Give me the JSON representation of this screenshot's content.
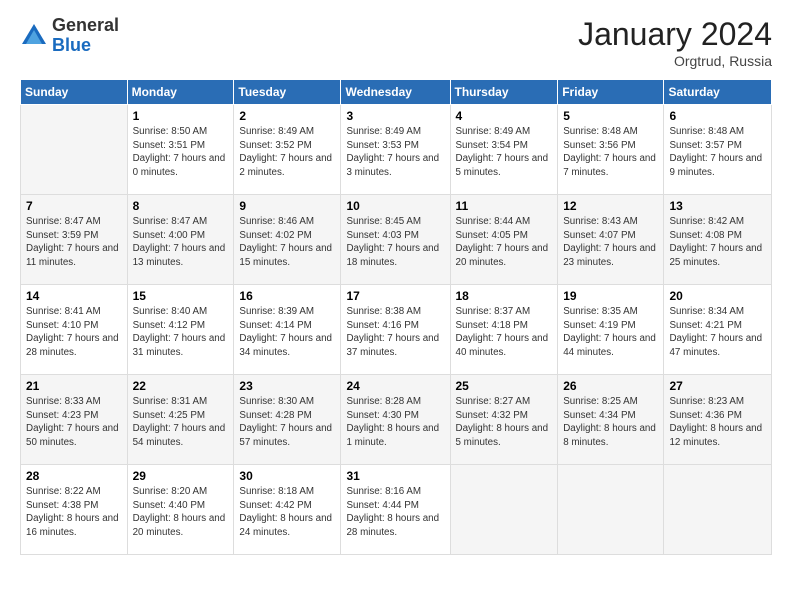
{
  "logo": {
    "general": "General",
    "blue": "Blue"
  },
  "header": {
    "month": "January 2024",
    "location": "Orgtrud, Russia"
  },
  "days_of_week": [
    "Sunday",
    "Monday",
    "Tuesday",
    "Wednesday",
    "Thursday",
    "Friday",
    "Saturday"
  ],
  "weeks": [
    [
      {
        "day": "",
        "empty": true
      },
      {
        "day": "1",
        "sunrise": "Sunrise: 8:50 AM",
        "sunset": "Sunset: 3:51 PM",
        "daylight": "Daylight: 7 hours and 0 minutes."
      },
      {
        "day": "2",
        "sunrise": "Sunrise: 8:49 AM",
        "sunset": "Sunset: 3:52 PM",
        "daylight": "Daylight: 7 hours and 2 minutes."
      },
      {
        "day": "3",
        "sunrise": "Sunrise: 8:49 AM",
        "sunset": "Sunset: 3:53 PM",
        "daylight": "Daylight: 7 hours and 3 minutes."
      },
      {
        "day": "4",
        "sunrise": "Sunrise: 8:49 AM",
        "sunset": "Sunset: 3:54 PM",
        "daylight": "Daylight: 7 hours and 5 minutes."
      },
      {
        "day": "5",
        "sunrise": "Sunrise: 8:48 AM",
        "sunset": "Sunset: 3:56 PM",
        "daylight": "Daylight: 7 hours and 7 minutes."
      },
      {
        "day": "6",
        "sunrise": "Sunrise: 8:48 AM",
        "sunset": "Sunset: 3:57 PM",
        "daylight": "Daylight: 7 hours and 9 minutes."
      }
    ],
    [
      {
        "day": "7",
        "sunrise": "Sunrise: 8:47 AM",
        "sunset": "Sunset: 3:59 PM",
        "daylight": "Daylight: 7 hours and 11 minutes."
      },
      {
        "day": "8",
        "sunrise": "Sunrise: 8:47 AM",
        "sunset": "Sunset: 4:00 PM",
        "daylight": "Daylight: 7 hours and 13 minutes."
      },
      {
        "day": "9",
        "sunrise": "Sunrise: 8:46 AM",
        "sunset": "Sunset: 4:02 PM",
        "daylight": "Daylight: 7 hours and 15 minutes."
      },
      {
        "day": "10",
        "sunrise": "Sunrise: 8:45 AM",
        "sunset": "Sunset: 4:03 PM",
        "daylight": "Daylight: 7 hours and 18 minutes."
      },
      {
        "day": "11",
        "sunrise": "Sunrise: 8:44 AM",
        "sunset": "Sunset: 4:05 PM",
        "daylight": "Daylight: 7 hours and 20 minutes."
      },
      {
        "day": "12",
        "sunrise": "Sunrise: 8:43 AM",
        "sunset": "Sunset: 4:07 PM",
        "daylight": "Daylight: 7 hours and 23 minutes."
      },
      {
        "day": "13",
        "sunrise": "Sunrise: 8:42 AM",
        "sunset": "Sunset: 4:08 PM",
        "daylight": "Daylight: 7 hours and 25 minutes."
      }
    ],
    [
      {
        "day": "14",
        "sunrise": "Sunrise: 8:41 AM",
        "sunset": "Sunset: 4:10 PM",
        "daylight": "Daylight: 7 hours and 28 minutes."
      },
      {
        "day": "15",
        "sunrise": "Sunrise: 8:40 AM",
        "sunset": "Sunset: 4:12 PM",
        "daylight": "Daylight: 7 hours and 31 minutes."
      },
      {
        "day": "16",
        "sunrise": "Sunrise: 8:39 AM",
        "sunset": "Sunset: 4:14 PM",
        "daylight": "Daylight: 7 hours and 34 minutes."
      },
      {
        "day": "17",
        "sunrise": "Sunrise: 8:38 AM",
        "sunset": "Sunset: 4:16 PM",
        "daylight": "Daylight: 7 hours and 37 minutes."
      },
      {
        "day": "18",
        "sunrise": "Sunrise: 8:37 AM",
        "sunset": "Sunset: 4:18 PM",
        "daylight": "Daylight: 7 hours and 40 minutes."
      },
      {
        "day": "19",
        "sunrise": "Sunrise: 8:35 AM",
        "sunset": "Sunset: 4:19 PM",
        "daylight": "Daylight: 7 hours and 44 minutes."
      },
      {
        "day": "20",
        "sunrise": "Sunrise: 8:34 AM",
        "sunset": "Sunset: 4:21 PM",
        "daylight": "Daylight: 7 hours and 47 minutes."
      }
    ],
    [
      {
        "day": "21",
        "sunrise": "Sunrise: 8:33 AM",
        "sunset": "Sunset: 4:23 PM",
        "daylight": "Daylight: 7 hours and 50 minutes."
      },
      {
        "day": "22",
        "sunrise": "Sunrise: 8:31 AM",
        "sunset": "Sunset: 4:25 PM",
        "daylight": "Daylight: 7 hours and 54 minutes."
      },
      {
        "day": "23",
        "sunrise": "Sunrise: 8:30 AM",
        "sunset": "Sunset: 4:28 PM",
        "daylight": "Daylight: 7 hours and 57 minutes."
      },
      {
        "day": "24",
        "sunrise": "Sunrise: 8:28 AM",
        "sunset": "Sunset: 4:30 PM",
        "daylight": "Daylight: 8 hours and 1 minute."
      },
      {
        "day": "25",
        "sunrise": "Sunrise: 8:27 AM",
        "sunset": "Sunset: 4:32 PM",
        "daylight": "Daylight: 8 hours and 5 minutes."
      },
      {
        "day": "26",
        "sunrise": "Sunrise: 8:25 AM",
        "sunset": "Sunset: 4:34 PM",
        "daylight": "Daylight: 8 hours and 8 minutes."
      },
      {
        "day": "27",
        "sunrise": "Sunrise: 8:23 AM",
        "sunset": "Sunset: 4:36 PM",
        "daylight": "Daylight: 8 hours and 12 minutes."
      }
    ],
    [
      {
        "day": "28",
        "sunrise": "Sunrise: 8:22 AM",
        "sunset": "Sunset: 4:38 PM",
        "daylight": "Daylight: 8 hours and 16 minutes."
      },
      {
        "day": "29",
        "sunrise": "Sunrise: 8:20 AM",
        "sunset": "Sunset: 4:40 PM",
        "daylight": "Daylight: 8 hours and 20 minutes."
      },
      {
        "day": "30",
        "sunrise": "Sunrise: 8:18 AM",
        "sunset": "Sunset: 4:42 PM",
        "daylight": "Daylight: 8 hours and 24 minutes."
      },
      {
        "day": "31",
        "sunrise": "Sunrise: 8:16 AM",
        "sunset": "Sunset: 4:44 PM",
        "daylight": "Daylight: 8 hours and 28 minutes."
      },
      {
        "day": "",
        "empty": true
      },
      {
        "day": "",
        "empty": true
      },
      {
        "day": "",
        "empty": true
      }
    ]
  ]
}
